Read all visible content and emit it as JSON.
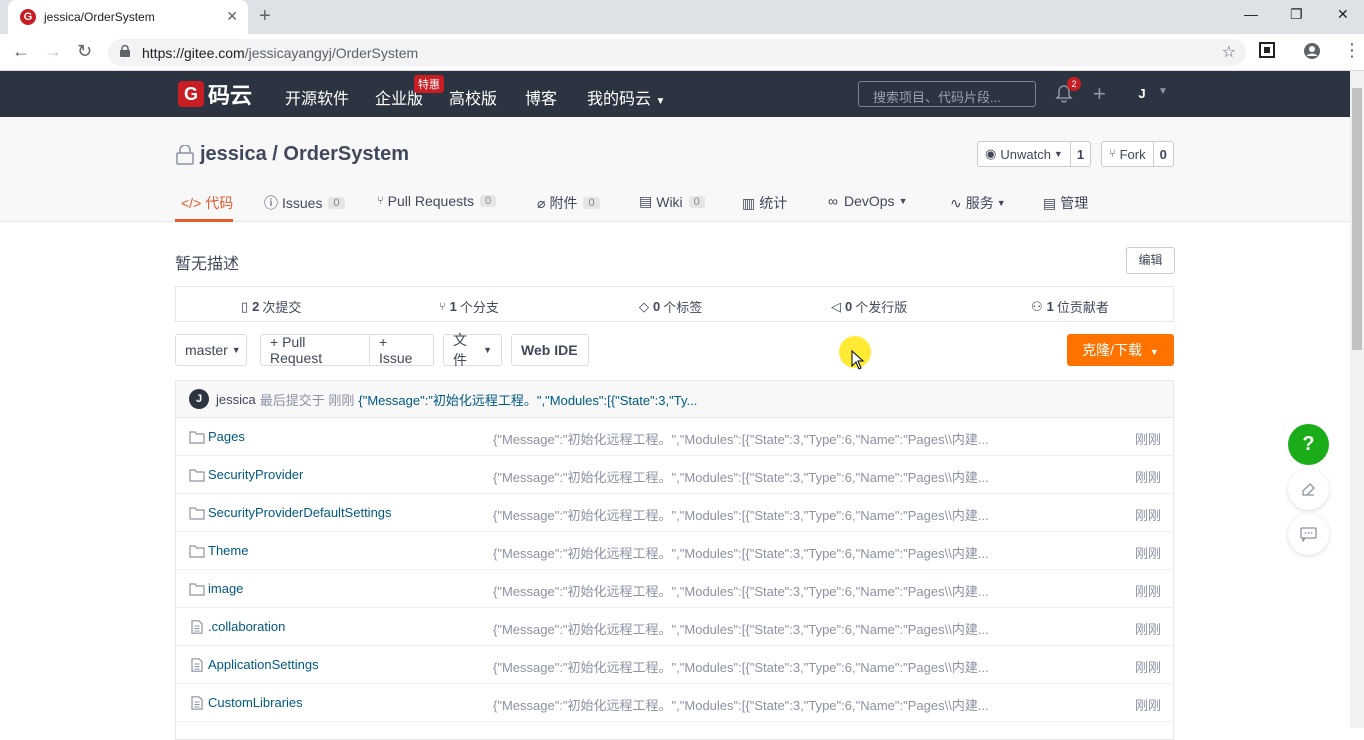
{
  "browser": {
    "tab_title": "jessica/OrderSystem",
    "url_host": "https://gitee.com",
    "url_path": "/jessicayangyj/OrderSystem",
    "favicon_letter": "G"
  },
  "header": {
    "logo_text": "码云",
    "nav": [
      "开源软件",
      "企业版",
      "高校版",
      "博客",
      "我的码云"
    ],
    "promo_badge": "特惠",
    "search_placeholder": "搜索项目、代码片段...",
    "notification_count": "2",
    "avatar_letter": "J"
  },
  "repo": {
    "title": "jessica / OrderSystem",
    "unwatch_label": "Unwatch",
    "unwatch_count": "1",
    "fork_label": "Fork",
    "fork_count": "0",
    "tabs": [
      {
        "label": "代码",
        "count": ""
      },
      {
        "label": "Issues",
        "count": "0"
      },
      {
        "label": "Pull Requests",
        "count": "0"
      },
      {
        "label": "附件",
        "count": "0"
      },
      {
        "label": "Wiki",
        "count": "0"
      },
      {
        "label": "统计",
        "count": ""
      },
      {
        "label": "DevOps",
        "count": ""
      },
      {
        "label": "服务",
        "count": ""
      },
      {
        "label": "管理",
        "count": ""
      }
    ]
  },
  "main": {
    "description": "暂无描述",
    "edit_label": "编辑",
    "stats": [
      {
        "num": "2",
        "label": "次提交"
      },
      {
        "num": "1",
        "label": "个分支"
      },
      {
        "num": "0",
        "label": "个标签"
      },
      {
        "num": "0",
        "label": "个发行版"
      },
      {
        "num": "1",
        "label": "位贡献者"
      }
    ],
    "branch": "master",
    "pr_label": "+ Pull Request",
    "issue_label": "+ Issue",
    "file_label": "文件",
    "webide_label": "Web IDE",
    "clone_label": "克隆/下载"
  },
  "commit": {
    "avatar_letter": "J",
    "user": "jessica",
    "meta": "最后提交于 刚刚",
    "message": "{\"Message\":\"初始化远程工程。\",\"Modules\":[{\"State\":3,\"Ty..."
  },
  "files": [
    {
      "name": "Pages",
      "type": "folder",
      "commit": "{\"Message\":\"初始化远程工程。\",\"Modules\":[{\"State\":3,\"Type\":6,\"Name\":\"Pages\\\\内建...",
      "time": "刚刚"
    },
    {
      "name": "SecurityProvider",
      "type": "folder",
      "commit": "{\"Message\":\"初始化远程工程。\",\"Modules\":[{\"State\":3,\"Type\":6,\"Name\":\"Pages\\\\内建...",
      "time": "刚刚"
    },
    {
      "name": "SecurityProviderDefaultSettings",
      "type": "folder",
      "commit": "{\"Message\":\"初始化远程工程。\",\"Modules\":[{\"State\":3,\"Type\":6,\"Name\":\"Pages\\\\内建...",
      "time": "刚刚"
    },
    {
      "name": "Theme",
      "type": "folder",
      "commit": "{\"Message\":\"初始化远程工程。\",\"Modules\":[{\"State\":3,\"Type\":6,\"Name\":\"Pages\\\\内建...",
      "time": "刚刚"
    },
    {
      "name": "image",
      "type": "folder",
      "commit": "{\"Message\":\"初始化远程工程。\",\"Modules\":[{\"State\":3,\"Type\":6,\"Name\":\"Pages\\\\内建...",
      "time": "刚刚"
    },
    {
      "name": ".collaboration",
      "type": "file",
      "commit": "{\"Message\":\"初始化远程工程。\",\"Modules\":[{\"State\":3,\"Type\":6,\"Name\":\"Pages\\\\内建...",
      "time": "刚刚"
    },
    {
      "name": "ApplicationSettings",
      "type": "file",
      "commit": "{\"Message\":\"初始化远程工程。\",\"Modules\":[{\"State\":3,\"Type\":6,\"Name\":\"Pages\\\\内建...",
      "time": "刚刚"
    },
    {
      "name": "CustomLibraries",
      "type": "file",
      "commit": "{\"Message\":\"初始化远程工程。\",\"Modules\":[{\"State\":3,\"Type\":6,\"Name\":\"Pages\\\\内建...",
      "time": "刚刚"
    }
  ],
  "floating": {
    "help_label": "?"
  },
  "colors": {
    "accent": "#e45a2b",
    "clone": "#fe7300",
    "header_bg": "#2b3440",
    "link": "#005980",
    "help": "#1aad19"
  }
}
